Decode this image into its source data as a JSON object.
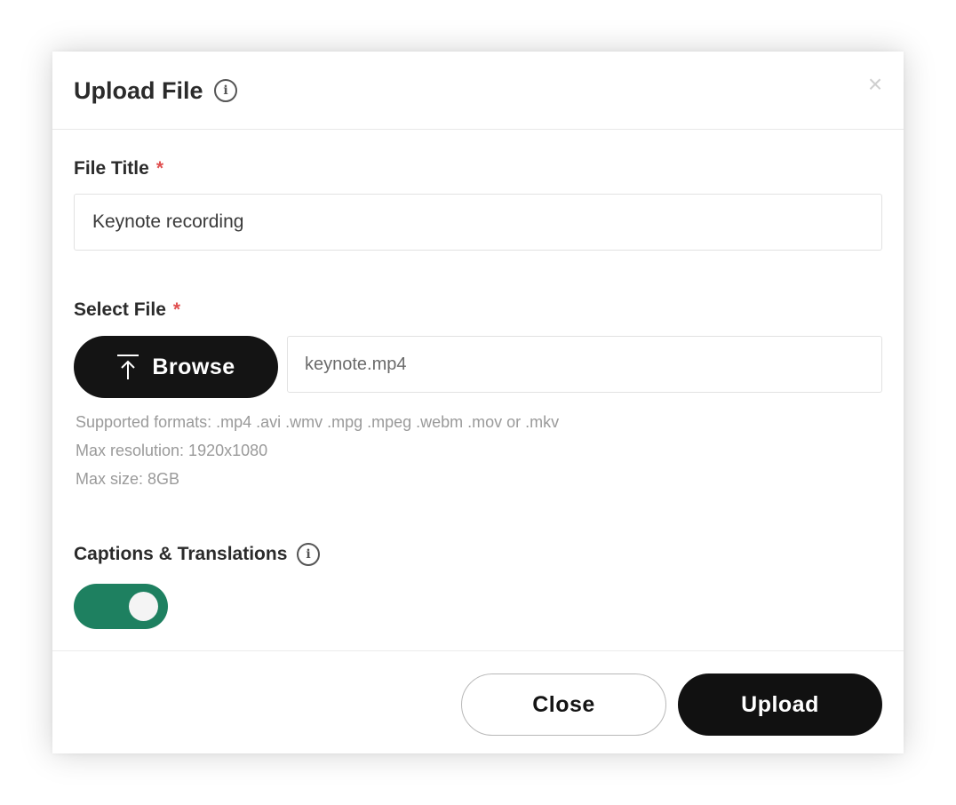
{
  "dialog": {
    "title": "Upload File",
    "title_info_icon": "info-icon",
    "close_icon": "close-icon",
    "close_glyph": "×"
  },
  "file_title": {
    "label": "File Title",
    "required_mark": "*",
    "value": "Keynote recording"
  },
  "select_file": {
    "label": "Select File",
    "required_mark": "*",
    "browse_label": "Browse",
    "browse_icon": "upload-icon",
    "file_name": "keynote.mp4",
    "hints": [
      "Supported formats: .mp4 .avi .wmv .mpg .mpeg .webm .mov or .mkv",
      "Max resolution: 1920x1080",
      "Max size: 8GB"
    ]
  },
  "captions": {
    "label": "Captions & Translations",
    "info_icon": "info-icon",
    "enabled": true
  },
  "footer": {
    "close_label": "Close",
    "upload_label": "Upload"
  },
  "colors": {
    "required": "#e05050",
    "toggle_on": "#1e8060",
    "primary_button": "#111111",
    "hint_text": "#9a9a9a"
  }
}
